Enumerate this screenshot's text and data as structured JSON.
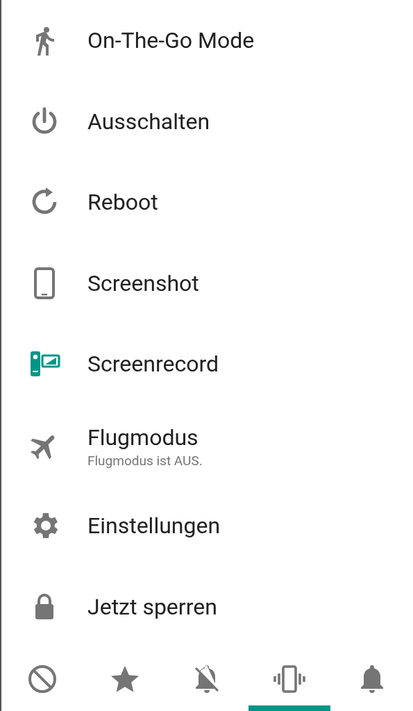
{
  "menu_items": [
    {
      "label": "On-The-Go Mode",
      "color": "#757575"
    },
    {
      "label": "Ausschalten",
      "color": "#757575"
    },
    {
      "label": "Reboot",
      "color": "#757575"
    },
    {
      "label": "Screenshot",
      "color": "#757575"
    },
    {
      "label": "Screenrecord",
      "color": "#009688"
    },
    {
      "label": "Flugmodus",
      "subtitle": "Flugmodus ist AUS.",
      "color": "#757575"
    },
    {
      "label": "Einstellungen",
      "color": "#757575"
    },
    {
      "label": "Jetzt sperren",
      "color": "#757575"
    }
  ],
  "sound_modes": [
    {
      "selected": false
    },
    {
      "selected": false
    },
    {
      "selected": false
    },
    {
      "selected": true
    },
    {
      "selected": false
    }
  ]
}
